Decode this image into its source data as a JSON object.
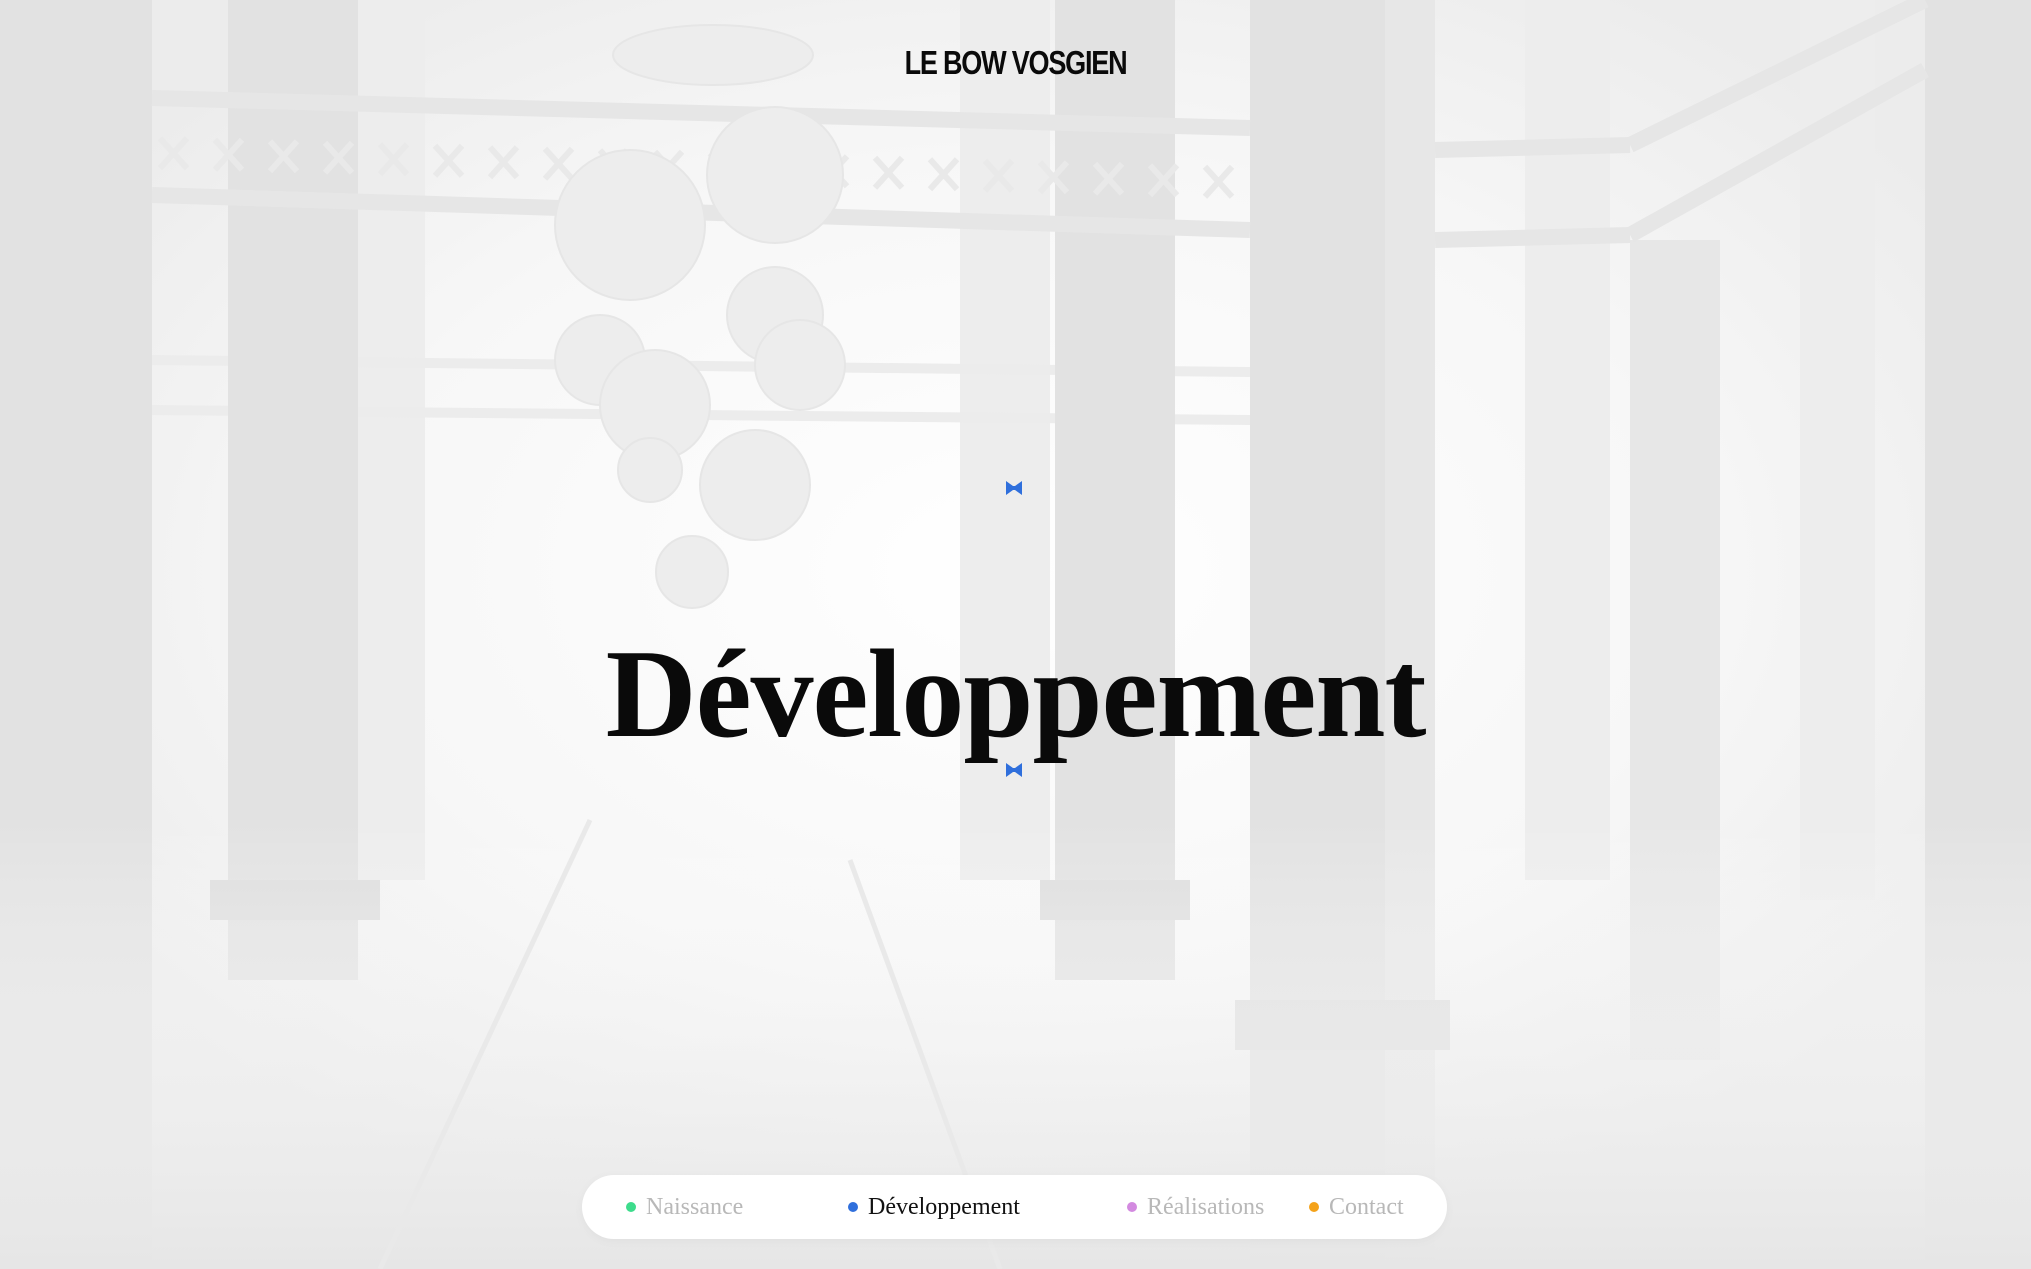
{
  "site": {
    "logo_text": "LE BOW VOSGIEN"
  },
  "hero": {
    "title": "Développement"
  },
  "icons": {
    "divider_top": "bowtie-icon",
    "divider_bottom": "bowtie-icon"
  },
  "colors": {
    "bowtie": "#2f6fdc",
    "naissance": "#3ddc8c",
    "developpement": "#2f6fdc",
    "realisations": "#d38ae0",
    "contact": "#f4a21a",
    "text_active": "#111111",
    "text_inactive": "#b8b8b8"
  },
  "nav": {
    "active": "Développement",
    "items": [
      {
        "label": "Naissance"
      },
      {
        "label": "Développement"
      },
      {
        "label": "Réalisations"
      },
      {
        "label": "Contact"
      }
    ]
  }
}
